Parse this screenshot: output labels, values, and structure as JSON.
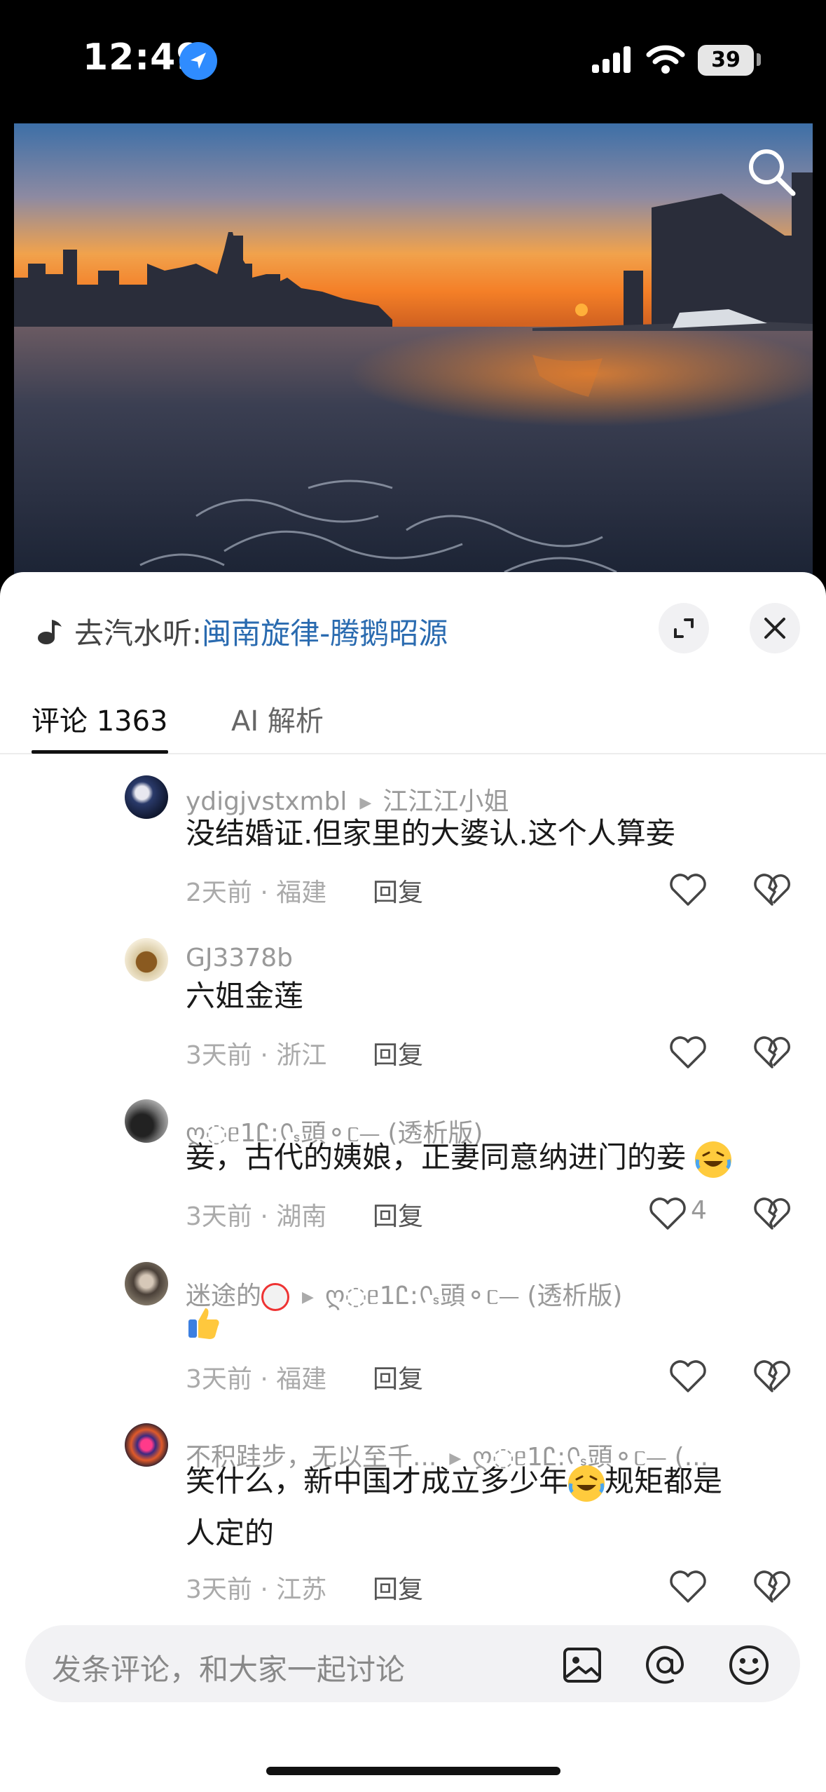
{
  "status_bar": {
    "time": "12:49",
    "battery": "39"
  },
  "music": {
    "prefix": "去汽水听:",
    "song": "闽南旋律-腾鹅昭源"
  },
  "tabs": [
    {
      "label": "评论 1363"
    },
    {
      "label": "AI 解析"
    }
  ],
  "comments": [
    {
      "user": "ydigjvstxmbl",
      "reply_to": "江江江小姐",
      "text": "没结婚证.但家里的大婆认.这个人算妾",
      "time_location": "2天前 · 福建",
      "reply_label": "回复",
      "likes": ""
    },
    {
      "user": "GJ3378b",
      "reply_to": "",
      "text": "六姐金莲",
      "time_location": "3天前 · 浙江",
      "reply_label": "回复",
      "likes": ""
    },
    {
      "user": "ღ◌ᥱ1Ꮭ:ᢉ𖾗頭⚬ᥴ⏤ (透析版)",
      "reply_to": "",
      "text": "妾，古代的姨娘，正妻同意纳进门的妾",
      "time_location": "3天前 · 湖南",
      "reply_label": "回复",
      "likes": "4"
    },
    {
      "user": "迷途的",
      "reply_to": "ღ◌ᥱ1Ꮭ:ᢉ𖾗頭⚬ᥴ⏤ (透析版)",
      "text": "",
      "time_location": "3天前 · 福建",
      "reply_label": "回复",
      "likes": ""
    },
    {
      "user": "不积跬步，无以至千...",
      "reply_to": "ღ◌ᥱ1Ꮭ:ᢉ𖾗頭⚬ᥴ⏤ (...",
      "text_part1": "笑什么，新中国才成立多少年",
      "text_part2": "规矩都是",
      "text_line2": "人定的",
      "time_location": "3天前 · 江苏",
      "reply_label": "回复",
      "likes": ""
    }
  ],
  "input": {
    "placeholder": "发条评论，和大家一起讨论"
  },
  "icons": {
    "search": "search-icon",
    "expand": "expand-icon",
    "close": "close-icon",
    "like": "heart-icon",
    "dislike": "broken-heart-icon",
    "image": "image-icon",
    "mention": "at-icon",
    "emoji": "smiley-icon"
  }
}
